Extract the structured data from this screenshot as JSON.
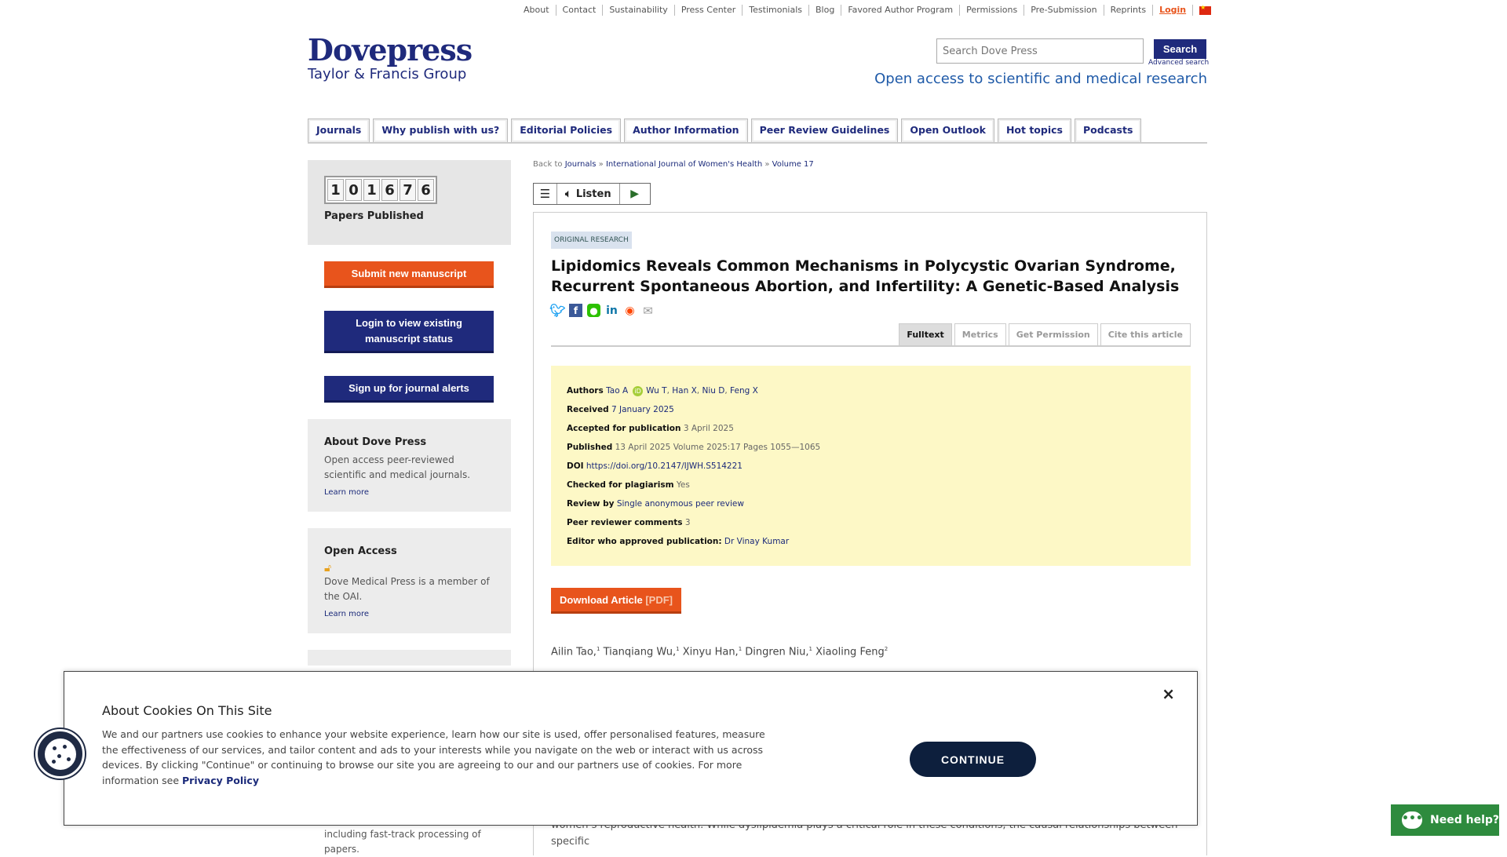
{
  "topnav": {
    "items": [
      "About",
      "Contact",
      "Sustainability",
      "Press Center",
      "Testimonials",
      "Blog",
      "Favored Author Program",
      "Permissions",
      "Pre-Submission",
      "Reprints"
    ],
    "login": "Login"
  },
  "logo": {
    "line1": "Dovepress",
    "line2": "Taylor & Francis Group"
  },
  "search": {
    "placeholder": "Search Dove Press",
    "button": "Search",
    "advanced": "Advanced search"
  },
  "tagline": "Open access to scientific and medical research",
  "mainnav": [
    "Journals",
    "Why publish with us?",
    "Editorial Policies",
    "Author Information",
    "Peer Review Guidelines",
    "Open Outlook",
    "Hot topics",
    "Podcasts"
  ],
  "sidebar": {
    "counter_digits": [
      "1",
      "0",
      "1",
      "6",
      "7",
      "6"
    ],
    "counter_label": "Papers Published",
    "submit": "Submit new manuscript",
    "login_status": "Login to view existing manuscript status",
    "alerts": "Sign up for journal alerts",
    "about": {
      "title": "About Dove Press",
      "text": "Open access peer-reviewed scientific and medical journals.",
      "link": "Learn more"
    },
    "open_access": {
      "title": "Open Access",
      "text": "Dove Medical Press is a member of the OAI.",
      "link": "Learn more"
    },
    "bottom_text": "including fast-track processing of papers."
  },
  "breadcrumb": {
    "prefix": "Back to",
    "journals": "Journals",
    "journal": "International Journal of Women's Health",
    "volume": "Volume 17"
  },
  "listen": {
    "label": "Listen"
  },
  "article": {
    "type": "ORIGINAL RESEARCH",
    "title": "Lipidomics Reveals Common Mechanisms in Polycystic Ovarian Syndrome, Recurrent Spontaneous Abortion, and Infertility: A Genetic-Based Analysis",
    "tabs": [
      "Fulltext",
      "Metrics",
      "Get Permission",
      "Cite this article"
    ],
    "meta": {
      "authors_label": "Authors",
      "authors": [
        "Tao A",
        "Wu T",
        "Han X",
        "Niu D",
        "Feng X"
      ],
      "received_label": "Received",
      "received": "7 January 2025",
      "accepted_label": "Accepted for publication",
      "accepted": "3 April 2025",
      "published_label": "Published",
      "published": "13 April 2025 Volume 2025:17 Pages 1055—1065",
      "doi_label": "DOI",
      "doi": "https://doi.org/10.2147/IJWH.S514221",
      "plagiarism_label": "Checked for plagiarism",
      "plagiarism": "Yes",
      "review_label": "Review by",
      "review": "Single anonymous peer review",
      "comments_label": "Peer reviewer comments",
      "comments": "3",
      "editor_label": "Editor who approved publication:",
      "editor": "Dr Vinay Kumar"
    },
    "download": "Download Article",
    "download_pdf": "[PDF]",
    "author_list": [
      {
        "name": "Ailin Tao,",
        "sup": "1"
      },
      {
        "name": "Tianqiang Wu,",
        "sup": "1"
      },
      {
        "name": "Xinyu Han,",
        "sup": "1"
      },
      {
        "name": "Dingren Niu,",
        "sup": "1"
      },
      {
        "name": "Xiaoling Feng",
        "sup": "2"
      }
    ],
    "abstract_line": "women’s reproductive health. While dyslipidemia plays a critical role in these conditions, the causal relationships between specific"
  },
  "cookie": {
    "title": "About Cookies On This Site",
    "text": "We and our partners use cookies to enhance your website experience, learn how our site is used, offer personalised features, measure the effectiveness of our services, and tailor content and ads to your interests while you navigate on the web or interact with us across devices. By clicking \"Continue\" or continuing to browse our site you are agreeing to our and our partners use of cookies. For more information see",
    "policy": "Privacy Policy",
    "continue": "CONTINUE",
    "close": "×"
  },
  "help": {
    "label": "Need help?"
  },
  "colors": {
    "brand_blue": "#1f2a7c",
    "accent_orange": "#e8541c",
    "meta_bg": "#fdf8c6",
    "help_green": "#2e8b3e"
  }
}
